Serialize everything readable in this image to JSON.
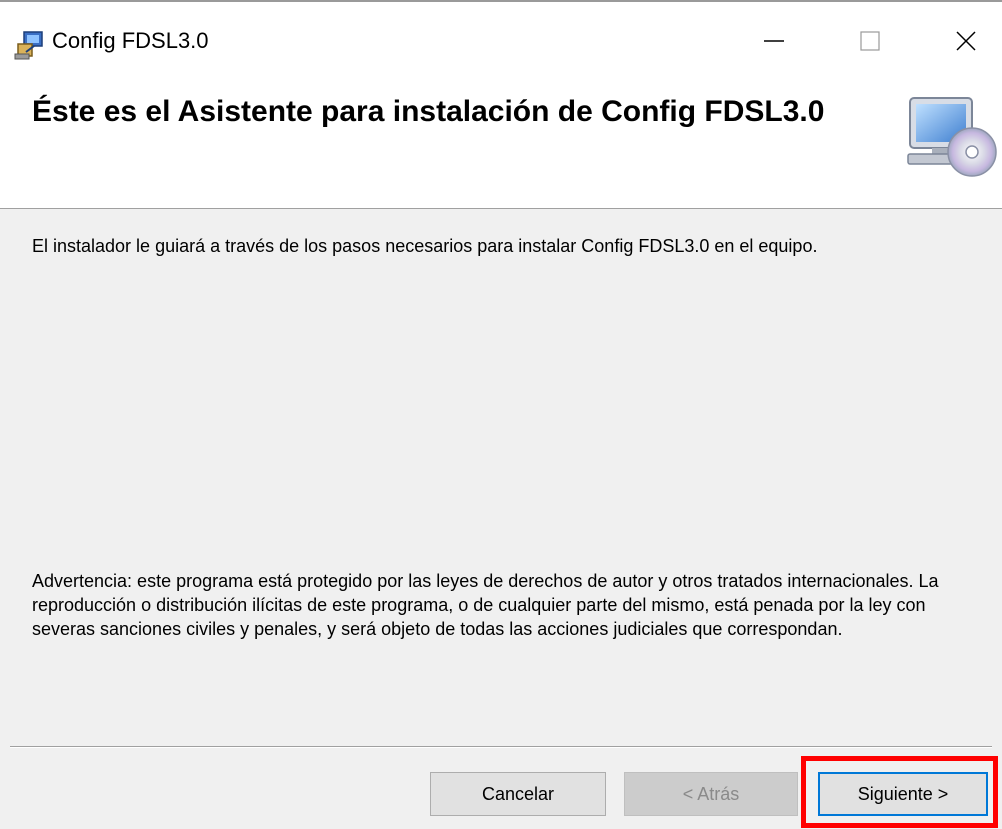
{
  "window": {
    "title": "Config FDSL3.0",
    "app_icon": "installer-icon",
    "controls": {
      "minimize_icon": "minimize-icon",
      "maximize_icon": "maximize-icon",
      "close_icon": "close-icon"
    }
  },
  "banner": {
    "title": "Éste es el Asistente para instalación de Config FDSL3.0",
    "icon": "computer-cd-icon"
  },
  "body": {
    "intro": "El instalador le guiará a través de los pasos necesarios para instalar Config FDSL3.0 en el equipo.",
    "warning": "Advertencia: este programa está protegido por las leyes de derechos de autor y otros tratados internacionales. La reproducción o distribución ilícitas de este programa, o de cualquier parte del mismo, está penada por la ley con severas sanciones civiles y penales, y será objeto de todas las acciones judiciales que correspondan."
  },
  "footer": {
    "cancel_label": "Cancelar",
    "back_label": "< Atrás",
    "next_label": "Siguiente >"
  },
  "colors": {
    "highlight": "#ff0000",
    "focus_border": "#0078d7"
  }
}
